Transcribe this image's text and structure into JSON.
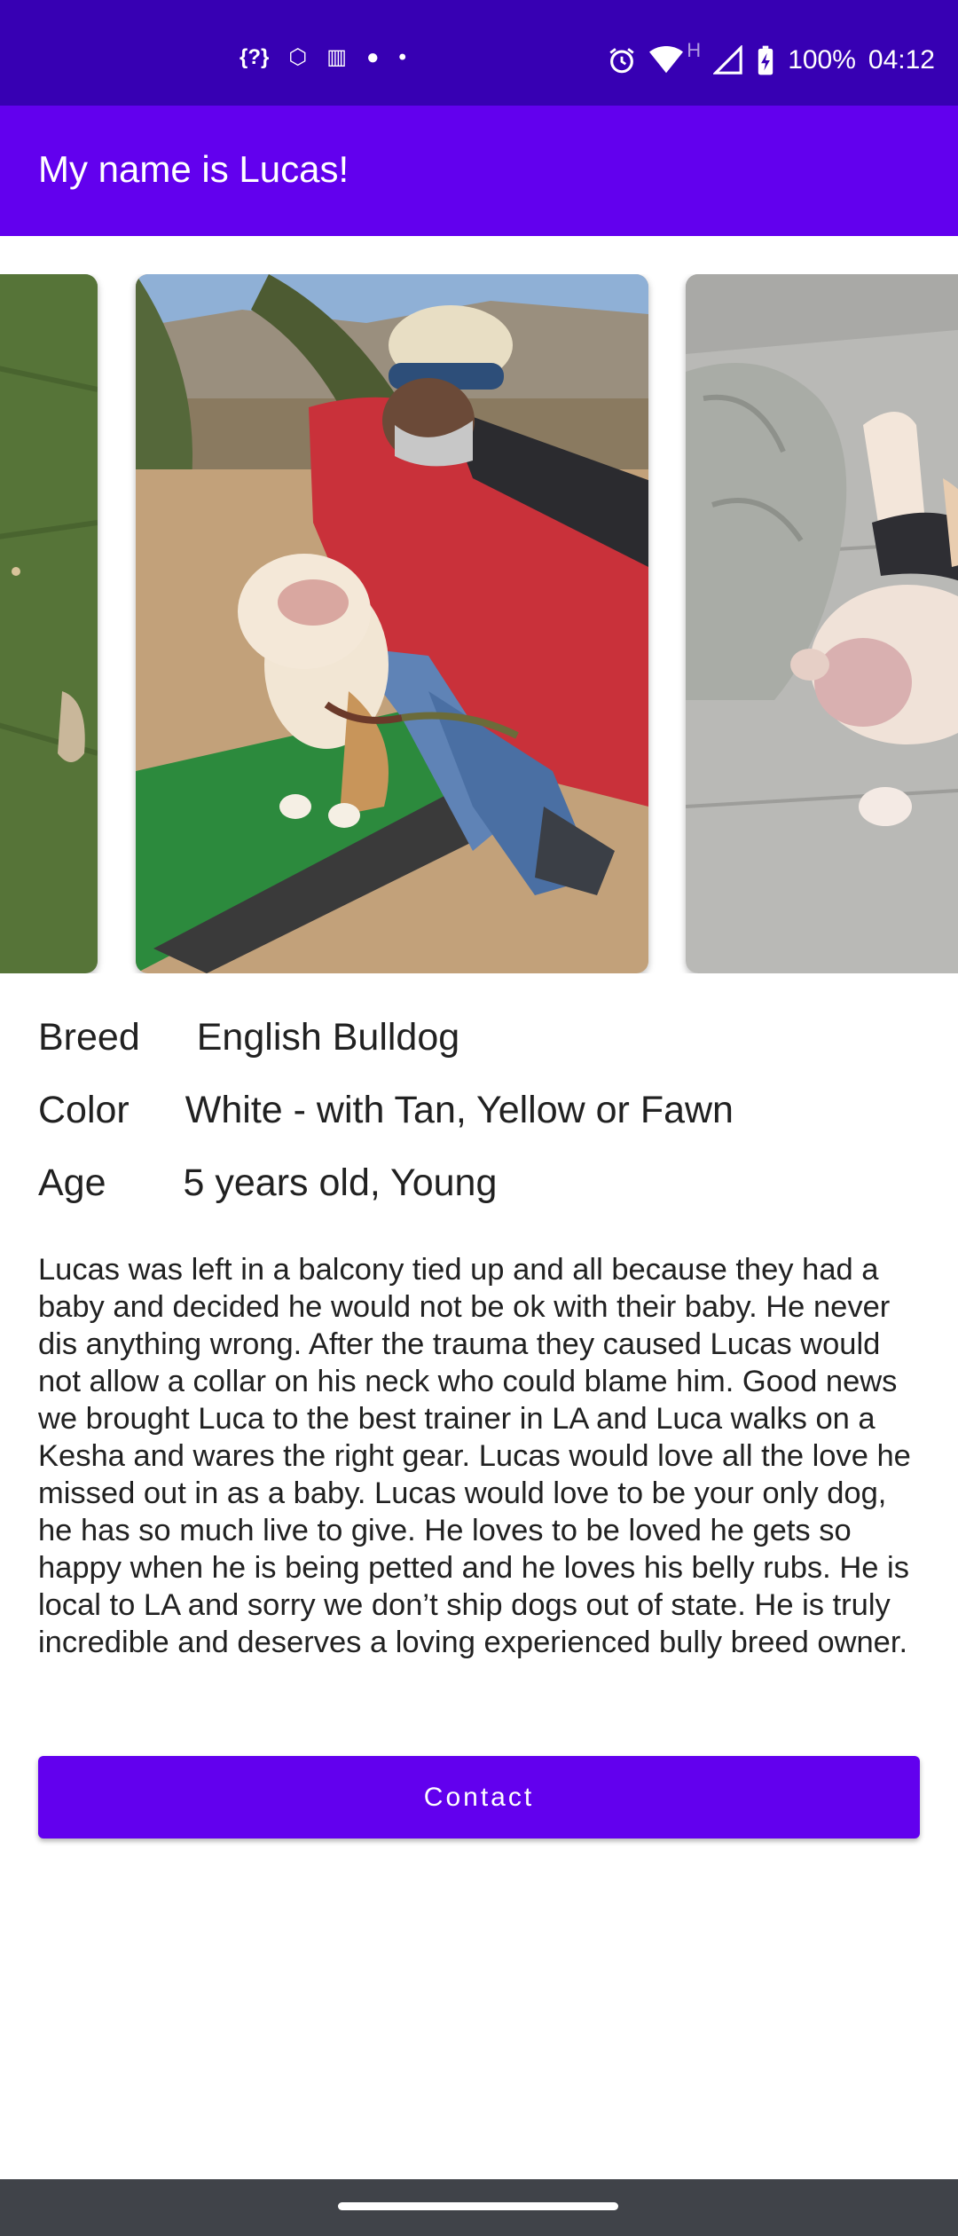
{
  "status_bar": {
    "left_icons": [
      "{?}",
      "⬡",
      "▥",
      "●",
      "•"
    ],
    "battery": "100%",
    "time": "04:12",
    "network_letter": "H"
  },
  "app_bar": {
    "title": "My name is Lucas!"
  },
  "carousel": {
    "images": [
      "bulldog-on-grass",
      "man-with-bulldog",
      "bulldog-on-blanket"
    ]
  },
  "details": {
    "breed_label": "Breed",
    "breed_value": "English Bulldog",
    "color_label": "Color",
    "color_value": "White - with Tan, Yellow or Fawn",
    "age_label": "Age",
    "age_value": "5 years old, Young"
  },
  "description": "Lucas was left in a balcony tied up and all because they had a baby and decided he would not be ok with their baby. He never dis anything wrong. After the trauma they caused Lucas would not allow a collar on his neck who could blame him. Good news we brought Luca to the best trainer in LA and Luca walks on a Kesha and wares the right gear. Lucas would love all the love he missed out in as a baby. Lucas would love to be your only dog, he has so much live to give. He loves to be loved he gets so happy when he is being petted and he loves his belly rubs. He is local to LA and sorry we don’t ship dogs out of state. He is truly incredible and deserves a loving experienced bully breed owner.",
  "contact_button": "Contact",
  "colors": {
    "status_bar": "#3700b3",
    "primary": "#6200ee",
    "nav_bar": "#404349"
  }
}
